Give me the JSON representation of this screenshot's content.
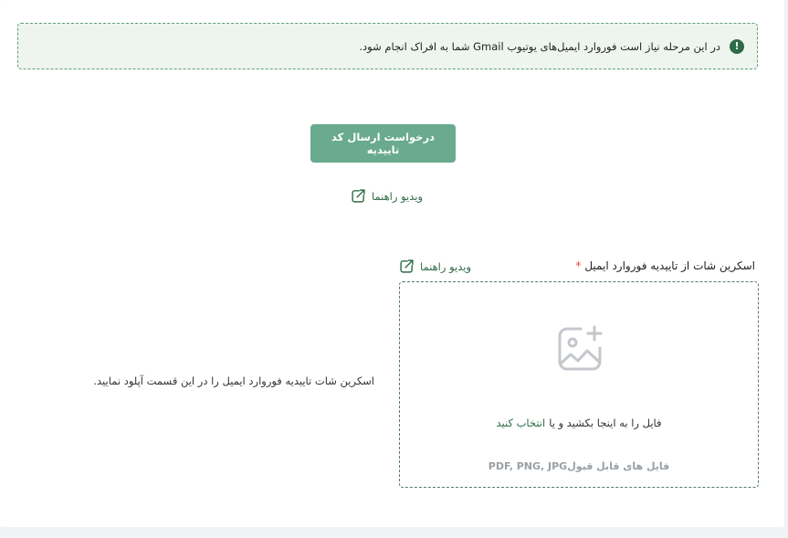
{
  "notice": {
    "icon": "exclamation-icon",
    "text": "در این مرحله نیاز است فوروارد ایمیل‌های یوتیوب Gmail شما به افراک انجام شود."
  },
  "actions": {
    "request_code_label": "درخواست ارسال کد تاییدیه",
    "video_guide_label": "ویدیو راهنما",
    "external_link_icon": "external-link-icon"
  },
  "upload": {
    "field_label": "اسکرین شات از تاییدیه فوروارد ایمیل",
    "required_mark": "*",
    "video_guide_label": "ویدیو راهنما",
    "icon": "image-add-icon",
    "drop_text": "فایل را به اینجا بکشید و یا",
    "choose_label": "انتخاب کنید",
    "accepted_types": "فایل های قابل قبولPDF, PNG, JPG",
    "side_hint": "اسکرین شات تاییدیه فوروارد ایمیل را در این قسمت آپلود نمایید."
  },
  "colors": {
    "accent": "#2f6b47",
    "button": "#6aaa8e",
    "notice_bg": "#eef5ef",
    "required": "#e0453a"
  }
}
